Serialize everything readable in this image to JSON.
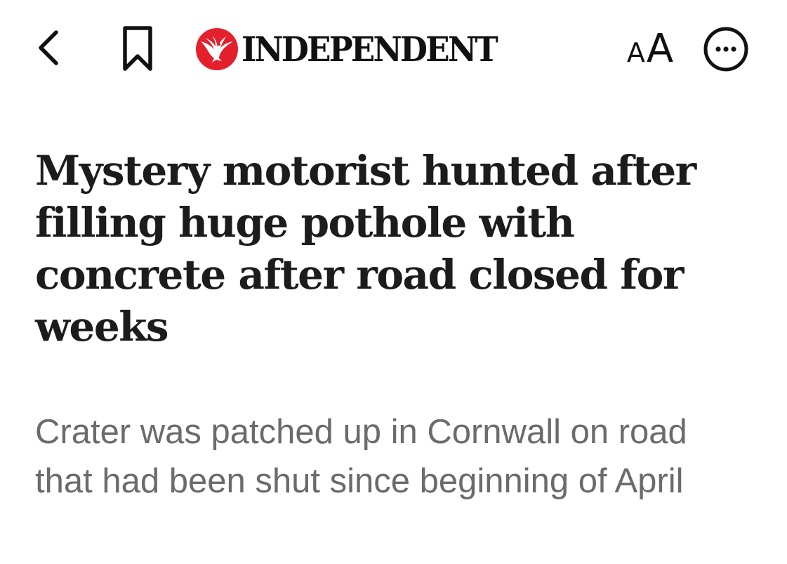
{
  "header": {
    "brand_name": "INDEPENDENT",
    "text_size_small": "A",
    "text_size_large": "A",
    "icons": {
      "back": "chevron-left-icon",
      "bookmark": "bookmark-icon",
      "logo": "eagle-logo",
      "more": "more-options-icon"
    },
    "colors": {
      "logo_red": "#e4202c",
      "icon": "#111111"
    }
  },
  "article": {
    "headline": "Mystery motorist hunted after filling huge pothole with concrete after road closed for weeks",
    "subheadline": "Crater was patched up in Cornwall on road that had been shut since beginning of April"
  },
  "colors": {
    "background": "#ffffff",
    "headline": "#1c1c1c",
    "subheadline": "#6b6b6b"
  }
}
